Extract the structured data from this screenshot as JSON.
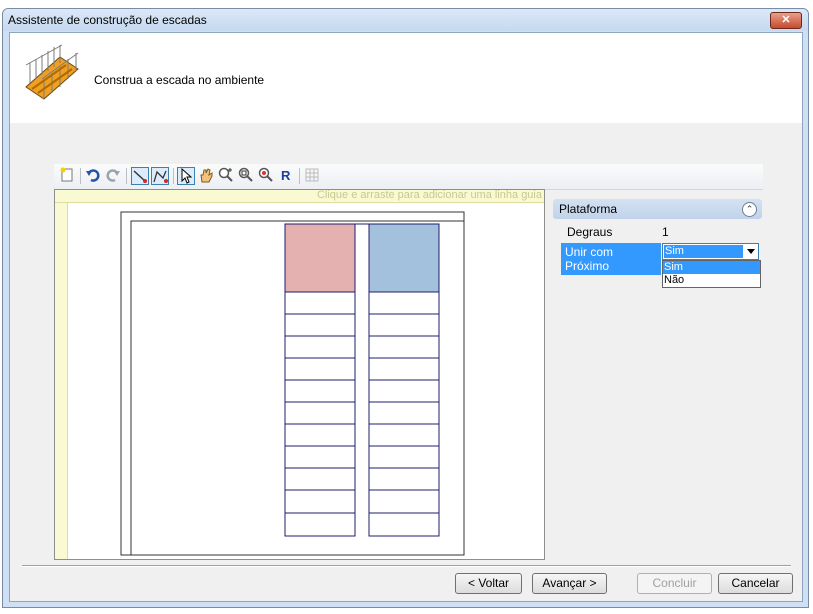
{
  "window": {
    "title": "Assistente de construção de escadas",
    "close_glyph": "✕"
  },
  "header": {
    "icon": "stair-icon",
    "text": "Construa a escada no ambiente"
  },
  "toolbar": {
    "buttons": [
      "new-icon",
      "undo-icon",
      "redo-icon",
      "draw-line-icon",
      "draw-polyline-icon",
      "select-arrow-icon",
      "pan-hand-icon",
      "zoom-in-icon",
      "zoom-window-icon",
      "zoom-fit-icon",
      "redraw-icon",
      "grid-disabled-icon"
    ],
    "active": [
      "draw-line-icon",
      "draw-polyline-icon",
      "select-arrow-icon"
    ]
  },
  "canvas": {
    "guide_hint": "Clique e arraste para adicionar uma linha guia",
    "colors": {
      "landing_left": "#e5b0b0",
      "landing_right": "#a3c1dd",
      "guide": "#fafad2",
      "step_line": "#1c1c6e"
    }
  },
  "properties": {
    "section_title": "Plataforma",
    "collapse_glyph": "⌃",
    "degraus_label": "Degraus",
    "degraus_value": "1",
    "unir_label": "Unir com Próximo",
    "unir_value": "Sim",
    "options": [
      "Sim",
      "Não"
    ]
  },
  "buttons": {
    "back": "< Voltar",
    "next": "Avançar >",
    "finish": "Concluir",
    "cancel": "Cancelar"
  }
}
